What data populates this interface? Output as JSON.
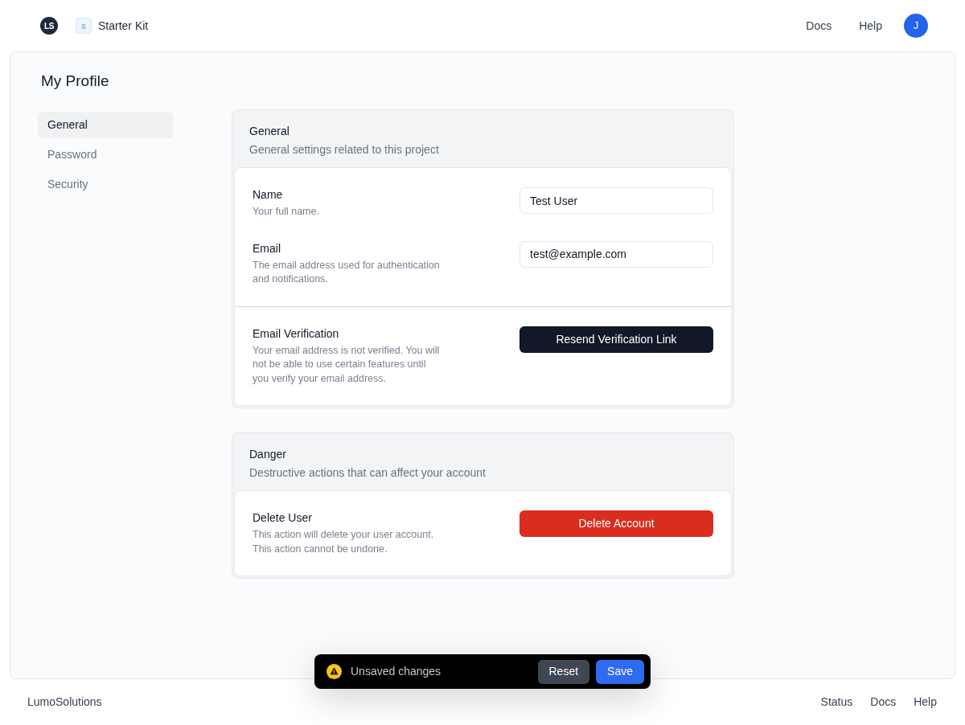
{
  "header": {
    "logo": "LS",
    "project_badge": "s",
    "project_name": "Starter Kit",
    "nav_links": [
      "Docs",
      "Help"
    ],
    "avatar": "J"
  },
  "page": {
    "title": "My Profile"
  },
  "sidebar": {
    "items": [
      {
        "label": "General",
        "selected": true
      },
      {
        "label": "Password",
        "selected": false
      },
      {
        "label": "Security",
        "selected": false
      }
    ]
  },
  "sections": [
    {
      "title": "General",
      "description": "General settings related to this project",
      "groups": [
        {
          "rows": [
            {
              "kind": "field",
              "label": "Name",
              "description": "Your full name.",
              "value": "Test User"
            },
            {
              "kind": "field",
              "label": "Email",
              "description": "The email address used for authentication and notifications.",
              "value": "test@example.com"
            }
          ]
        },
        {
          "rows": [
            {
              "kind": "action",
              "label": "Email Verification",
              "description": "Your email address is not verified. You will not be able to use certain features until you verify your email address.",
              "button": {
                "label": "Resend Verification Link",
                "kind": "primary"
              }
            }
          ]
        }
      ]
    },
    {
      "title": "Danger",
      "description": "Destructive actions that can affect your account",
      "groups": [
        {
          "rows": [
            {
              "kind": "action",
              "label": "Delete User",
              "description": "This action will delete your user account. This action cannot be undone.",
              "button": {
                "label": "Delete Account",
                "kind": "danger"
              }
            }
          ]
        }
      ]
    }
  ],
  "unsaved_bar": {
    "message": "Unsaved changes",
    "buttons": [
      {
        "label": "Reset",
        "kind": "secondary"
      },
      {
        "label": "Save",
        "kind": "primary"
      }
    ]
  },
  "footer": {
    "brand": "LumoSolutions",
    "links": [
      "Status",
      "Docs",
      "Help"
    ]
  }
}
